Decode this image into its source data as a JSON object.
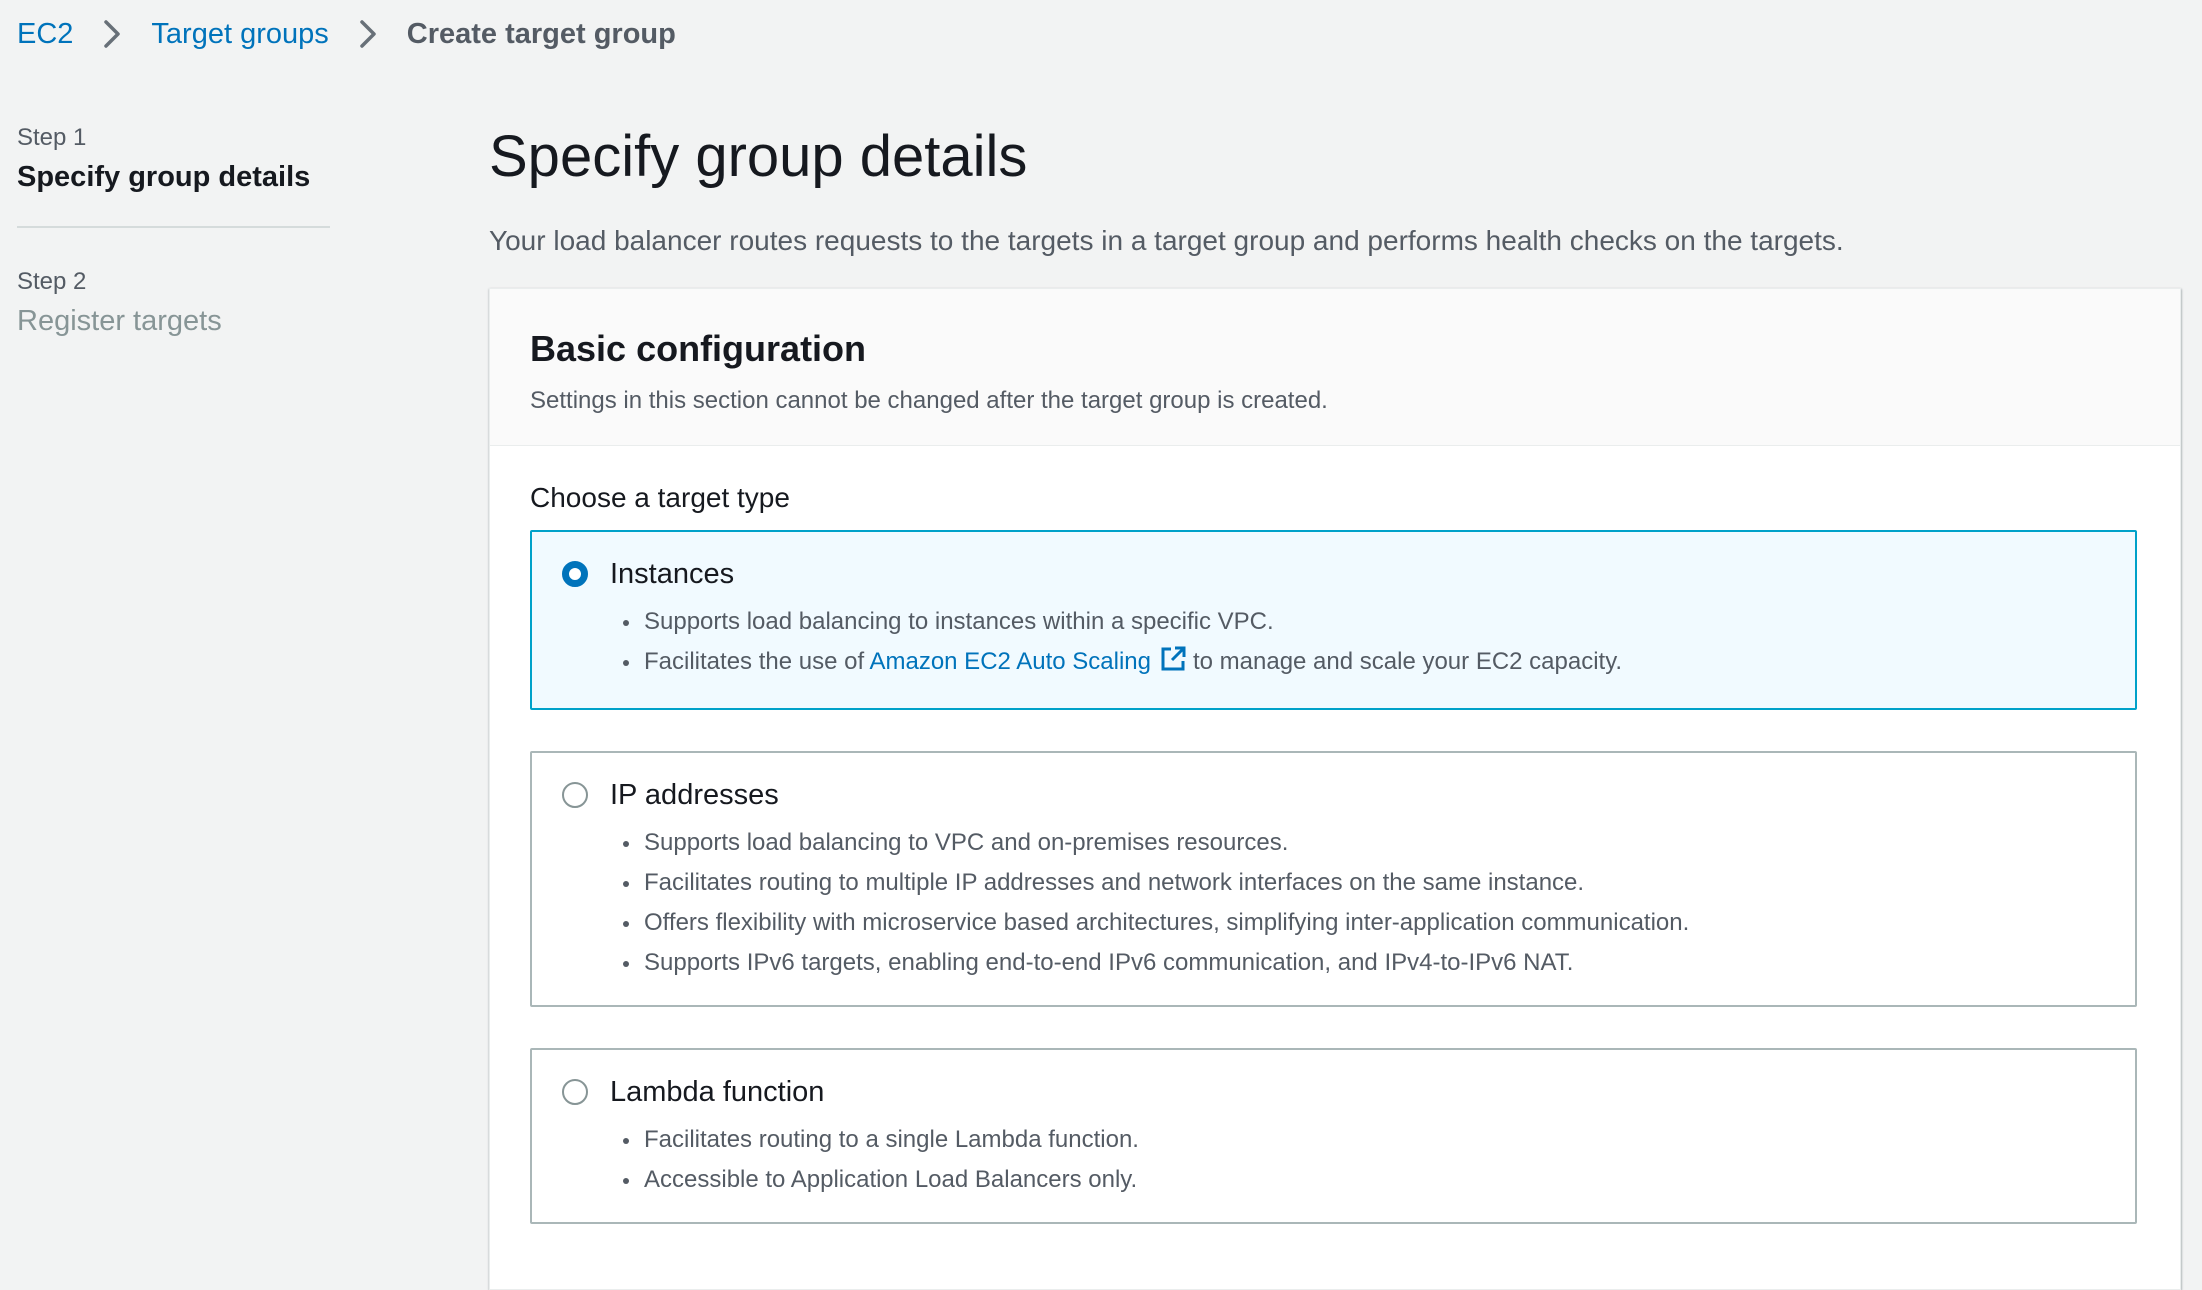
{
  "breadcrumb": {
    "items": [
      {
        "label": "EC2"
      },
      {
        "label": "Target groups"
      },
      {
        "label": "Create target group"
      }
    ]
  },
  "steps": [
    {
      "step_label": "Step 1",
      "title": "Specify group details",
      "state": "active"
    },
    {
      "step_label": "Step 2",
      "title": "Register targets",
      "state": "inactive"
    }
  ],
  "main": {
    "title": "Specify group details",
    "description": "Your load balancer routes requests to the targets in a target group and performs health checks on the targets."
  },
  "basic_config": {
    "title": "Basic configuration",
    "subtitle": "Settings in this section cannot be changed after the target group is created.",
    "target_type_label": "Choose a target type",
    "options": [
      {
        "title": "Instances",
        "selected": true,
        "bullets": [
          "Supports load balancing to instances within a specific VPC."
        ],
        "bullet_with_link": {
          "before": "Facilitates the use of",
          "link": "Amazon EC2 Auto Scaling",
          "after": "to manage and scale your EC2 capacity."
        }
      },
      {
        "title": "IP addresses",
        "selected": false,
        "bullets": [
          "Supports load balancing to VPC and on-premises resources.",
          "Facilitates routing to multiple IP addresses and network interfaces on the same instance.",
          "Offers flexibility with microservice based architectures, simplifying inter-application communication.",
          "Supports IPv6 targets, enabling end-to-end IPv6 communication, and IPv4-to-IPv6 NAT."
        ]
      },
      {
        "title": "Lambda function",
        "selected": false,
        "bullets": [
          "Facilitates routing to a single Lambda function.",
          "Accessible to Application Load Balancers only."
        ]
      }
    ]
  },
  "icons": {
    "breadcrumb_separator": "chevron-right-icon",
    "external_link": "external-link-icon"
  },
  "colors": {
    "link": "#0073bb",
    "selected_border": "#00a1c9",
    "selected_bg": "#f1faff",
    "page_bg": "#f2f3f3"
  }
}
